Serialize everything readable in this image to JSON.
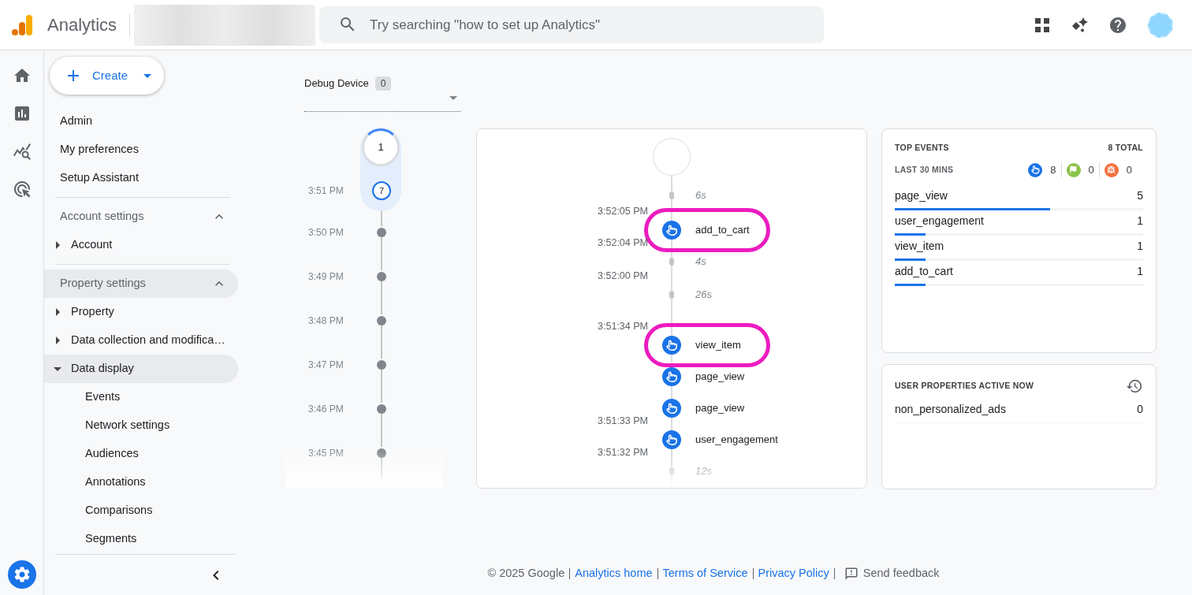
{
  "header": {
    "product": "Analytics",
    "search": {
      "placeholder": "Try searching \"how to set up Analytics\""
    }
  },
  "create_button": {
    "label": "Create"
  },
  "sidebar": {
    "top_links": [
      "Admin",
      "My preferences",
      "Setup Assistant"
    ],
    "sections": [
      {
        "title": "Account settings",
        "expanded": true,
        "selected": false,
        "items": [
          {
            "label": "Account",
            "expanded": false,
            "selected": false
          }
        ]
      },
      {
        "title": "Property settings",
        "expanded": true,
        "selected": true,
        "items": [
          {
            "label": "Property",
            "expanded": false,
            "selected": false
          },
          {
            "label": "Data collection and modifica…",
            "expanded": false,
            "selected": false
          },
          {
            "label": "Data display",
            "expanded": true,
            "selected": true,
            "children": [
              "Events",
              "Network settings",
              "Audiences",
              "Annotations",
              "Comparisons",
              "Segments"
            ]
          }
        ]
      }
    ]
  },
  "debug_device": {
    "label": "Debug Device",
    "count": "0"
  },
  "minutes": {
    "top_count": "1",
    "rows": [
      {
        "time": "3:51 PM",
        "count": "7",
        "selected": true
      },
      {
        "time": "3:50 PM",
        "selected": false
      },
      {
        "time": "3:49 PM",
        "selected": false
      },
      {
        "time": "3:48 PM",
        "selected": false
      },
      {
        "time": "3:47 PM",
        "selected": false
      },
      {
        "time": "3:46 PM",
        "selected": false
      },
      {
        "time": "3:45 PM",
        "selected": false
      }
    ]
  },
  "seconds_stream": [
    {
      "kind": "gap",
      "label": "6s"
    },
    {
      "kind": "time",
      "label": "3:52:05 PM"
    },
    {
      "kind": "event",
      "label": "add_to_cart",
      "highlighted": true
    },
    {
      "kind": "time",
      "label": "3:52:04 PM"
    },
    {
      "kind": "gap",
      "label": "4s"
    },
    {
      "kind": "time",
      "label": "3:52:00 PM"
    },
    {
      "kind": "gap",
      "label": "26s"
    },
    {
      "kind": "time",
      "label": "3:51:34 PM"
    },
    {
      "kind": "event",
      "label": "view_item",
      "highlighted": true
    },
    {
      "kind": "event",
      "label": "page_view",
      "highlighted": false
    },
    {
      "kind": "event",
      "label": "page_view",
      "highlighted": false
    },
    {
      "kind": "time",
      "label": "3:51:33 PM"
    },
    {
      "kind": "event",
      "label": "user_engagement",
      "highlighted": false
    },
    {
      "kind": "time",
      "label": "3:51:32 PM"
    },
    {
      "kind": "gap",
      "label": "12s"
    }
  ],
  "top_events": {
    "title": "TOP EVENTS",
    "total": "8 TOTAL",
    "period": "LAST 30 MINS",
    "counts": [
      {
        "kind": "event",
        "color": "#1a73e8",
        "count": "8"
      },
      {
        "kind": "conversion",
        "color": "#8bc34a",
        "count": "0"
      },
      {
        "kind": "error",
        "color": "#f2703d",
        "count": "0"
      }
    ],
    "rows": [
      {
        "name": "page_view",
        "count": "5",
        "level": 0.625
      },
      {
        "name": "user_engagement",
        "count": "1",
        "level": 0.125
      },
      {
        "name": "view_item",
        "count": "1",
        "level": 0.125
      },
      {
        "name": "add_to_cart",
        "count": "1",
        "level": 0.125
      }
    ]
  },
  "user_properties": {
    "title": "USER PROPERTIES ACTIVE NOW",
    "rows": [
      {
        "name": "non_personalized_ads",
        "value": "0"
      }
    ]
  },
  "footer": {
    "copyright": "© 2025 Google",
    "links": [
      "Analytics home",
      "Terms of Service",
      "Privacy Policy"
    ],
    "feedback": "Send feedback"
  }
}
